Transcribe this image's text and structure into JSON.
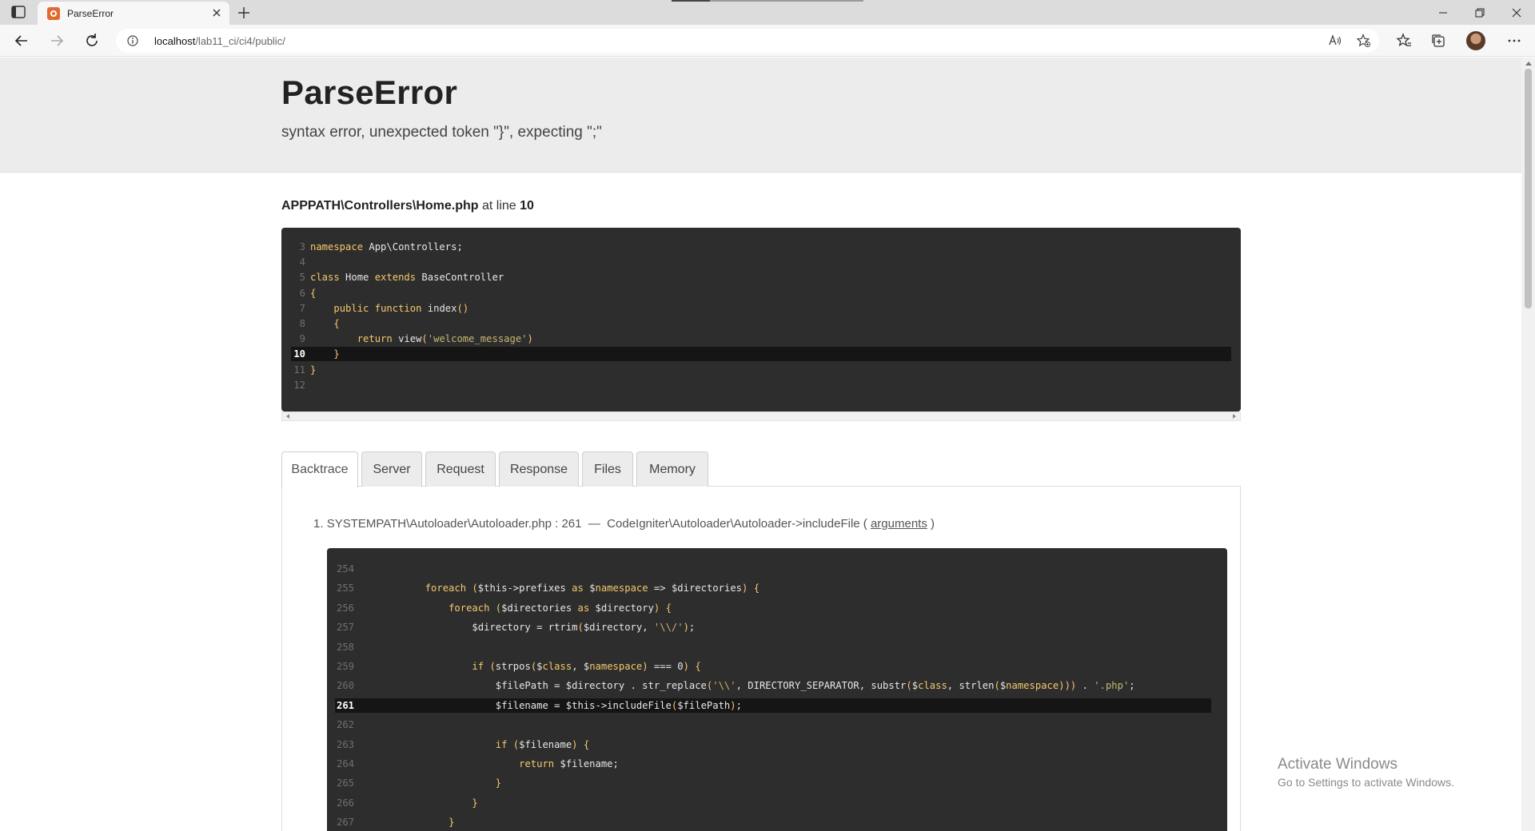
{
  "browser": {
    "tab_title": "ParseError",
    "url_host": "localhost",
    "url_path": "/lab11_ci/ci4/public/",
    "icons": [
      "sidebar-icon",
      "close-icon",
      "plus-icon",
      "minimize-icon",
      "restore-icon",
      "close-window-icon",
      "back-icon",
      "forward-icon",
      "refresh-icon",
      "info-icon",
      "read-aloud-icon",
      "add-favorite-icon",
      "favorites-icon",
      "collections-icon",
      "profile-avatar",
      "more-icon"
    ]
  },
  "error": {
    "title": "ParseError",
    "message": "syntax error, unexpected token \"}\", expecting \";\"",
    "file": "APPPATH\\Controllers\\Home.php",
    "at_line_label": "at line",
    "line": "10"
  },
  "source": {
    "highlight": "10",
    "lines": [
      {
        "n": "3",
        "code": "namespace App\\Controllers;"
      },
      {
        "n": "4",
        "code": ""
      },
      {
        "n": "5",
        "code": "class Home extends BaseController"
      },
      {
        "n": "6",
        "code": "{"
      },
      {
        "n": "7",
        "code": "    public function index()"
      },
      {
        "n": "8",
        "code": "    {"
      },
      {
        "n": "9",
        "code": "        return view('welcome_message')"
      },
      {
        "n": "10",
        "code": "    }"
      },
      {
        "n": "11",
        "code": "}"
      },
      {
        "n": "12",
        "code": ""
      }
    ]
  },
  "tabs": [
    "Backtrace",
    "Server",
    "Request",
    "Response",
    "Files",
    "Memory"
  ],
  "active_tab": "Backtrace",
  "backtrace": {
    "index": "1.",
    "file": "SYSTEMPATH\\Autoloader\\Autoloader.php : 261",
    "dash": "—",
    "call": "CodeIgniter\\Autoloader\\Autoloader->includeFile (",
    "arguments_link": "arguments",
    "close": ")",
    "highlight": "261",
    "lines": [
      {
        "n": "254",
        "code": ""
      },
      {
        "n": "255",
        "code": "        foreach ($this->prefixes as $namespace => $directories) {"
      },
      {
        "n": "256",
        "code": "            foreach ($directories as $directory) {"
      },
      {
        "n": "257",
        "code": "                $directory = rtrim($directory, '\\\\/');"
      },
      {
        "n": "258",
        "code": ""
      },
      {
        "n": "259",
        "code": "                if (strpos($class, $namespace) === 0) {"
      },
      {
        "n": "260",
        "code": "                    $filePath = $directory . str_replace('\\\\', DIRECTORY_SEPARATOR, substr($class, strlen($namespace))) . '.php';"
      },
      {
        "n": "261",
        "code": "                    $filename = $this->includeFile($filePath);"
      },
      {
        "n": "262",
        "code": ""
      },
      {
        "n": "263",
        "code": "                    if ($filename) {"
      },
      {
        "n": "264",
        "code": "                        return $filename;"
      },
      {
        "n": "265",
        "code": "                    }"
      },
      {
        "n": "266",
        "code": "                }"
      },
      {
        "n": "267",
        "code": "            }"
      }
    ]
  },
  "watermark": {
    "line1": "Activate Windows",
    "line2": "Go to Settings to activate Windows."
  },
  "colors": {
    "header_bg": "#ececec",
    "code_bg": "#2d2d2d",
    "keyword": "#f5c96b",
    "string": "#c7b773"
  }
}
